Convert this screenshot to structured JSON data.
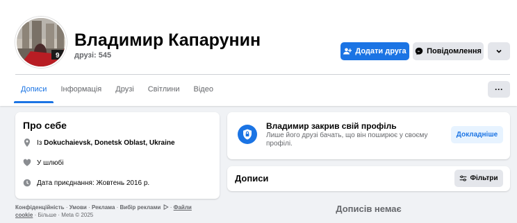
{
  "profile": {
    "name": "Владимир Капарунин",
    "friends": "друзі: 545"
  },
  "actions": {
    "add_friend": "Додати друга",
    "message": "Повідомлення"
  },
  "tabs": [
    {
      "label": "Дописи",
      "active": true
    },
    {
      "label": "Інформація",
      "active": false
    },
    {
      "label": "Друзі",
      "active": false
    },
    {
      "label": "Світлини",
      "active": false
    },
    {
      "label": "Відео",
      "active": false
    }
  ],
  "tab_more": "···",
  "about": {
    "title": "Про себе",
    "from_prefix": "Із ",
    "from_place": "Dokuchaievsk, Donetsk Oblast, Ukraine",
    "relationship": "У шлюбі",
    "joined": "Дата приєднання: Жовтень 2016 р."
  },
  "footer": {
    "privacy": "Конфіденційність",
    "terms": "Умови",
    "ads": "Реклама",
    "ad_choices": "Вибір реклами",
    "cookies_1": "Файли",
    "cookies_2": "cookie",
    "more": "Більше",
    "copyright": "Meta © 2025",
    "sep": " · "
  },
  "locked": {
    "title": "Владимир закрив свій профіль",
    "description": "Лише його друзі бачать, що він поширює у своєму профілі.",
    "learn_more": "Докладніше"
  },
  "posts": {
    "title": "Дописи",
    "filters": "Фільтри",
    "empty": "Дописів немає"
  },
  "colors": {
    "accent": "#1b74e4",
    "background": "#f0f2f5",
    "secondary_text": "#65676b"
  },
  "icons": [
    "add-friend-icon",
    "messenger-icon",
    "chevron-down-icon",
    "location-icon",
    "heart-icon",
    "clock-icon",
    "shield-icon",
    "filter-icon",
    "ad-choices-icon"
  ]
}
